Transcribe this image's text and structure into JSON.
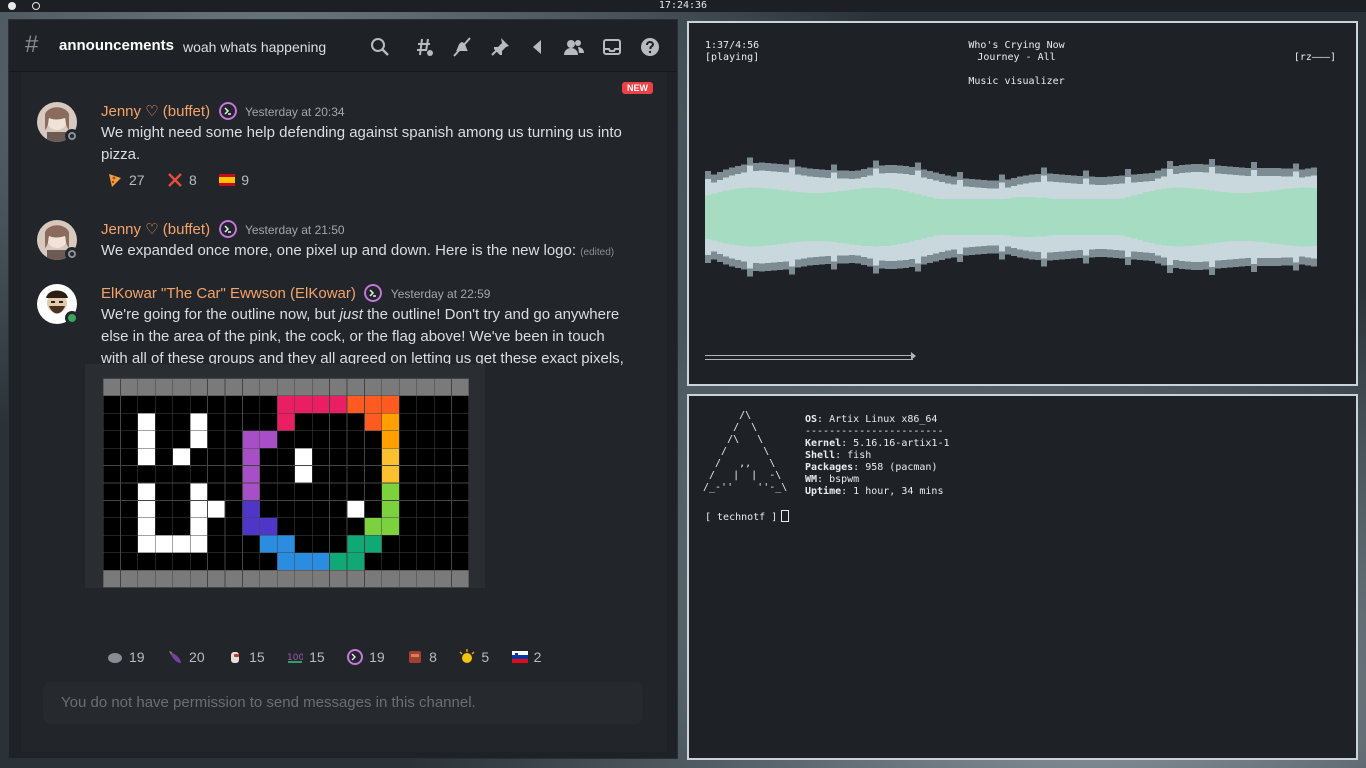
{
  "topbar": {
    "clock": "17:24:36"
  },
  "discord": {
    "channel": {
      "name": "announcements",
      "topic": "woah whats happening"
    },
    "header_icons": [
      "search-icon",
      "threads-icon",
      "mute-icon",
      "pin-icon",
      "back-icon",
      "members-icon",
      "inbox-icon",
      "help-icon"
    ],
    "new_badge": "NEW",
    "messages": [
      {
        "author": "Jenny ♡ (buffet)",
        "timestamp": "Yesterday at 20:34",
        "text": "We might need some help defending against spanish among us turning us into pizza.",
        "reactions": [
          {
            "emoji": "pizza",
            "count": "27"
          },
          {
            "emoji": "cross",
            "count": "8"
          },
          {
            "emoji": "flag-es",
            "count": "9"
          }
        ]
      },
      {
        "author": "Jenny ♡ (buffet)",
        "timestamp": "Yesterday at 21:50",
        "text": "We expanded once more, one pixel up and down. Here is the new logo:",
        "edited": "(edited)"
      },
      {
        "author": "ElKowar \"The Car\" Ewwson (ElKowar)",
        "timestamp": "Yesterday at 22:59",
        "text_before": "We're going for the outline now, but ",
        "text_em": "just",
        "text_after": " the outline! Don't try and go anywhere else in the area of the pink, the cock, or the flag above! We've been in touch with all of these groups and they all agreed on letting us get these exact pixels, no more or less",
        "reactions": [
          {
            "emoji": "rock",
            "count": "19"
          },
          {
            "emoji": "eggplant",
            "count": "20"
          },
          {
            "emoji": "amongus",
            "count": "15"
          },
          {
            "emoji": "hundred",
            "count": "15"
          },
          {
            "emoji": "eww",
            "count": "19"
          },
          {
            "emoji": "meat",
            "count": "8"
          },
          {
            "emoji": "clap",
            "count": "5"
          },
          {
            "emoji": "flag-si",
            "count": "2"
          }
        ]
      }
    ],
    "input_placeholder": "You do not have permission to send messages in this channel."
  },
  "visualizer": {
    "time": "1:37/4:56",
    "state": "[playing]",
    "song": "Who's Crying Now",
    "album": "Journey - All",
    "mode": "[rz———]",
    "label": "Music visualizer",
    "progress": 0.33
  },
  "fetch": {
    "info": [
      {
        "key": "OS",
        "value": ": Artix Linux x86_64"
      },
      {
        "key": "",
        "value": "-----------------------"
      },
      {
        "key": "Kernel",
        "value": ": 5.16.16-artix1-1"
      },
      {
        "key": "Shell",
        "value": ": fish"
      },
      {
        "key": "Packages",
        "value": ": 958 (pacman)"
      },
      {
        "key": "WM",
        "value": ": bspwm"
      },
      {
        "key": "Uptime",
        "value": ": 1 hour, 34 mins"
      }
    ],
    "prompt": "[ technotf ]"
  }
}
